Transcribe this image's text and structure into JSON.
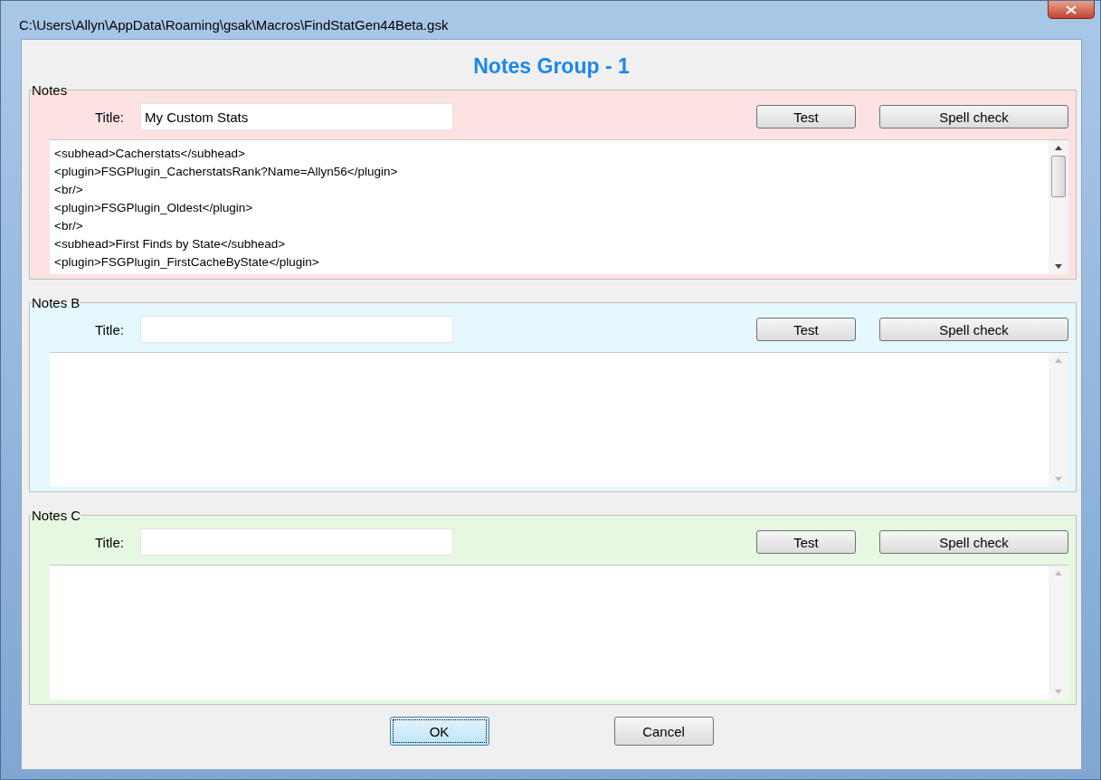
{
  "window": {
    "title": "C:\\Users\\Allyn\\AppData\\Roaming\\gsak\\Macros\\FindStatGen44Beta.gsk"
  },
  "heading": "Notes Group - 1",
  "groups": [
    {
      "legend": "Notes",
      "color": "#fde2e2",
      "title_label": "Title:",
      "title_value": "My Custom Stats",
      "test_button": "Test",
      "spell_button": "Spell check",
      "lines": [
        "<subhead>Cacherstats</subhead>",
        "<plugin>FSGPlugin_CacherstatsRank?Name=Allyn56</plugin>",
        "<br/>",
        "<plugin>FSGPlugin_Oldest</plugin>",
        "<br/>",
        "<subhead>First Finds by State</subhead>",
        "<plugin>FSGPlugin_FirstCacheByState</plugin>"
      ]
    },
    {
      "legend": "Notes B",
      "color": "#e4f8fd",
      "title_label": "Title:",
      "test_button": "Test",
      "spell_button": "Spell check"
    },
    {
      "legend": "Notes C",
      "color": "#e6f8e2",
      "title_label": "Title:",
      "test_button": "Test",
      "spell_button": "Spell check"
    }
  ],
  "buttons": [
    {
      "label": "OK",
      "focused": true
    },
    {
      "label": "Cancel",
      "focused": false
    }
  ]
}
